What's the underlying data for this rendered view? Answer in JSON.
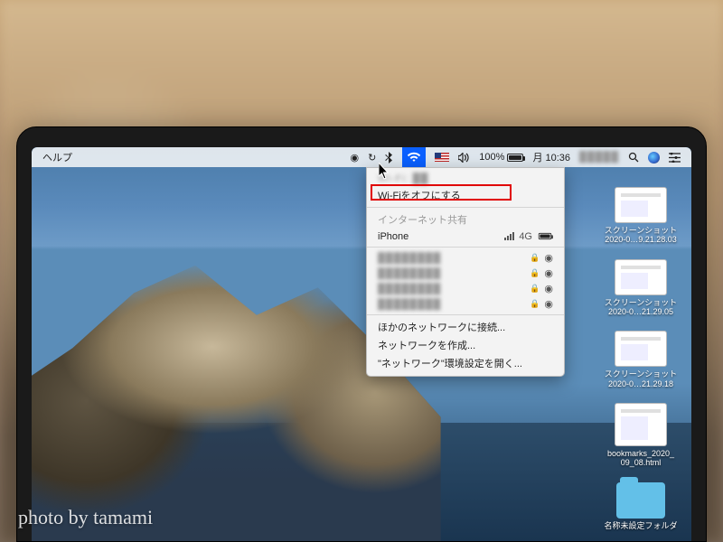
{
  "menubar": {
    "help_label": "ヘルプ",
    "battery_pct": "100%",
    "clock": "月 10:36"
  },
  "wifi_menu": {
    "turn_off": "Wi-Fiをオフにする",
    "internet_sharing": "インターネット共有",
    "iphone_label": "iPhone",
    "iphone_signal": "4G",
    "networks": [
      {
        "name": "████████",
        "locked": true
      },
      {
        "name": "████████",
        "locked": true
      },
      {
        "name": "████████",
        "locked": true
      },
      {
        "name": "████████",
        "locked": true
      }
    ],
    "connect_other": "ほかのネットワークに接続...",
    "create_network": "ネットワークを作成...",
    "open_prefs": "\"ネットワーク\"環境設定を開く..."
  },
  "desktop_items": [
    {
      "line1": "スクリーンショット",
      "line2": "2020-0…9.21.28.03",
      "kind": "screenshot"
    },
    {
      "line1": "スクリーンショット",
      "line2": "2020-0…21.29.05",
      "kind": "screenshot"
    },
    {
      "line1": "スクリーンショット",
      "line2": "2020-0…21.29.18",
      "kind": "screenshot"
    },
    {
      "line1": "bookmarks_2020_",
      "line2": "09_08.html",
      "kind": "file"
    },
    {
      "line1": "名称未設定フォルダ",
      "line2": "",
      "kind": "folder"
    }
  ],
  "watermark": "photo by tamami"
}
